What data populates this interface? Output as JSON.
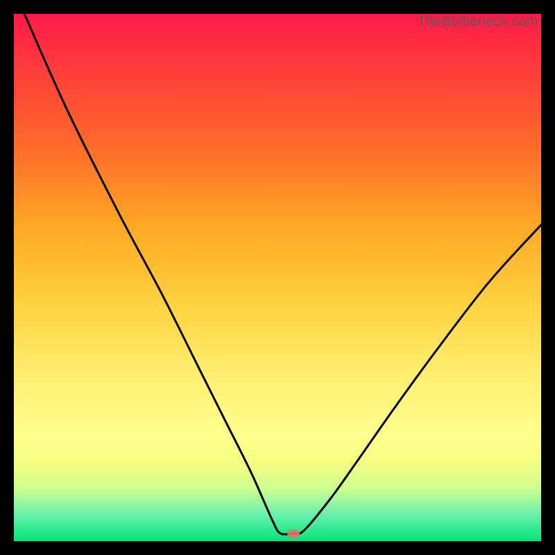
{
  "watermark": "TheBottleneck.com",
  "chart_data": {
    "type": "line",
    "title": "",
    "xlabel": "",
    "ylabel": "",
    "xlim": [
      0,
      100
    ],
    "ylim": [
      0,
      100
    ],
    "grid": false,
    "legend": false,
    "series": [
      {
        "name": "bottleneck-curve",
        "x": [
          2,
          10,
          20,
          28,
          35,
          40,
          45,
          49,
          50.5,
          53,
          55,
          60,
          65,
          72,
          80,
          90,
          100
        ],
        "values": [
          100,
          82,
          62,
          47,
          33,
          23,
          13,
          4,
          1.5,
          1.5,
          2,
          8,
          15,
          25,
          36,
          49,
          60
        ]
      }
    ],
    "marker": {
      "x": 53,
      "y": 1.5,
      "color": "#d97a6c"
    },
    "gradient_stops": [
      {
        "pos": 0,
        "color": "#ff1a4a"
      },
      {
        "pos": 25,
        "color": "#ff6a2a"
      },
      {
        "pos": 55,
        "color": "#ffd23f"
      },
      {
        "pos": 80,
        "color": "#ffff8d"
      },
      {
        "pos": 100,
        "color": "#00e676"
      }
    ]
  }
}
